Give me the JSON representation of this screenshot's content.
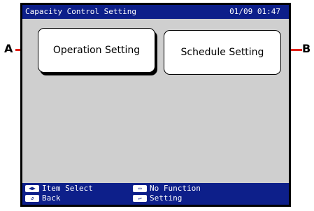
{
  "title_bar": {
    "title": "Capacity Control Setting",
    "datetime": "01/09 01:47"
  },
  "buttons": {
    "operation_setting": "Operation Setting",
    "schedule_setting": "Schedule Setting"
  },
  "callouts": {
    "a": "A",
    "b": "B"
  },
  "footer": {
    "item_select": "Item Select",
    "back": "Back",
    "no_function": "No Function",
    "setting": "Setting"
  },
  "colors": {
    "bar": "#0d1f8a",
    "panel": "#cfcfcf",
    "callout_line": "#e2231a"
  },
  "icons": [
    "arrow-left-right-icon",
    "return-back-icon",
    "menu-button-icon",
    "enter-icon"
  ]
}
